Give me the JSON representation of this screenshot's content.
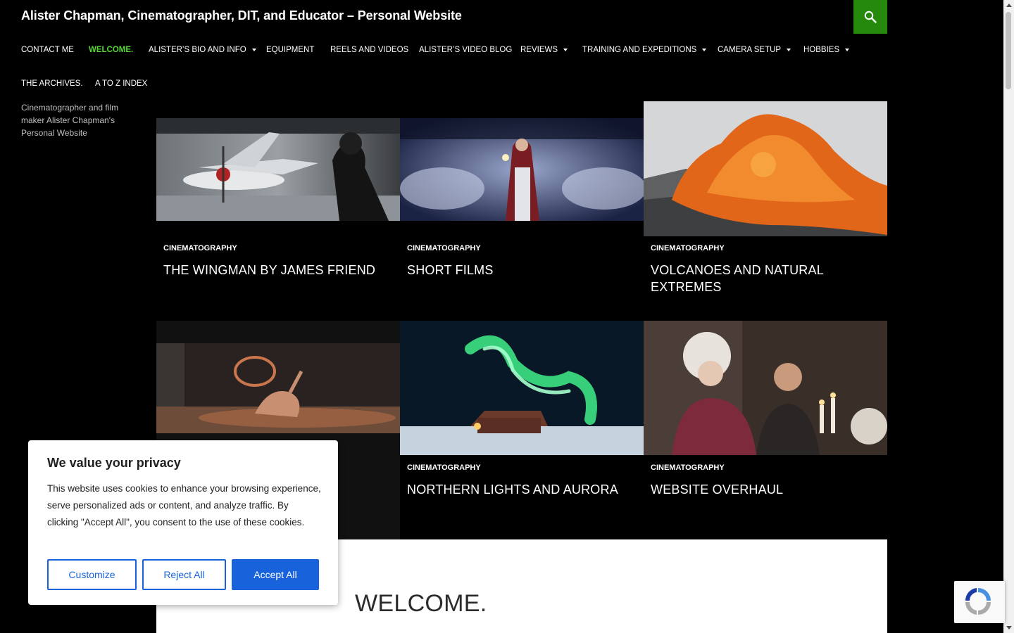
{
  "header": {
    "site_title": "Alister Chapman, Cinematographer, DIT, and Educator – Personal Website",
    "search_icon": "search-icon",
    "accent_color": "#24890d"
  },
  "nav": {
    "row1": [
      {
        "label": "CONTACT ME",
        "has_submenu": false,
        "active": false
      },
      {
        "label": "WELCOME.",
        "has_submenu": false,
        "active": true
      },
      {
        "label": "ALISTER’S BIO AND INFO",
        "has_submenu": true,
        "active": false
      },
      {
        "label": "EQUIPMENT",
        "has_submenu": false,
        "active": false
      },
      {
        "label": "REELS AND VIDEOS",
        "has_submenu": false,
        "active": false
      },
      {
        "label": "ALISTER’S VIDEO BLOG",
        "has_submenu": false,
        "active": false
      },
      {
        "label": "REVIEWS",
        "has_submenu": true,
        "active": false
      },
      {
        "label": "TRAINING AND EXPEDITIONS",
        "has_submenu": true,
        "active": false
      },
      {
        "label": "CAMERA SETUP",
        "has_submenu": true,
        "active": false
      },
      {
        "label": "HOBBIES",
        "has_submenu": true,
        "active": false
      }
    ],
    "row2": [
      {
        "label": "THE ARCHIVES.",
        "has_submenu": false,
        "active": false
      },
      {
        "label": "A TO Z INDEX",
        "has_submenu": false,
        "active": false
      }
    ],
    "active_color": "#55d737"
  },
  "sidebar": {
    "description": "Cinematographer and film maker Alister Chapman's Personal Website"
  },
  "featured": [
    {
      "category": "CINEMATOGRAPHY",
      "title": "THE WINGMAN BY JAMES FRIEND"
    },
    {
      "category": "CINEMATOGRAPHY",
      "title": "SHORT FILMS"
    },
    {
      "category": "CINEMATOGRAPHY",
      "title": "VOLCANOES AND NATURAL EXTREMES"
    },
    {
      "category": "",
      "title": ""
    },
    {
      "category": "CINEMATOGRAPHY",
      "title": "NORTHERN LIGHTS AND AURORA"
    },
    {
      "category": "CINEMATOGRAPHY",
      "title": "WEBSITE OVERHAUL"
    }
  ],
  "content": {
    "heading": "WELCOME."
  },
  "cookie_banner": {
    "heading": "We value your privacy",
    "body": "This website uses cookies to enhance your browsing experience, serve personalized ads or content, and analyze traffic. By clicking \"Accept All\", you consent to the use of these cookies.",
    "customize_label": "Customize",
    "reject_label": "Reject All",
    "accept_label": "Accept All",
    "button_color": "#1863dc"
  }
}
